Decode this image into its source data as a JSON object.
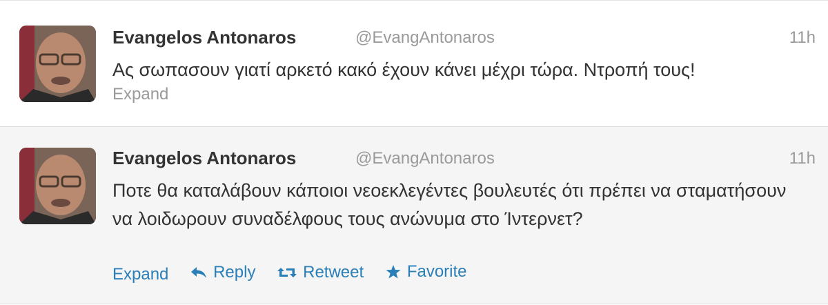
{
  "tweets": [
    {
      "name": "Evangelos Antonaros",
      "handle": "@EvangAntonaros",
      "time": "11h",
      "text": "Ας σωπασουν γιατί αρκετό κακό έχουν κάνει μέχρι τώρα. Ντροπή τους!",
      "expand_label": "Expand"
    },
    {
      "name": "Evangelos Antonaros",
      "handle": "@EvangAntonaros",
      "time": "11h",
      "text": "Ποτε θα καταλάβουν κάποιοι νεοεκλεγέντες βουλευτές ότι πρέπει να σταματήσουν να λοιδωρουν συναδέλφους τους ανώνυμα στο Ίντερνετ?",
      "actions": {
        "expand": "Expand",
        "reply": "Reply",
        "retweet": "Retweet",
        "favorite": "Favorite"
      }
    }
  ],
  "colors": {
    "link": "#2a7fb8",
    "muted": "#9a9a9a",
    "text": "#333333",
    "hover_bg": "#f5f5f5"
  },
  "icons": [
    "reply-icon",
    "retweet-icon",
    "star-icon"
  ]
}
